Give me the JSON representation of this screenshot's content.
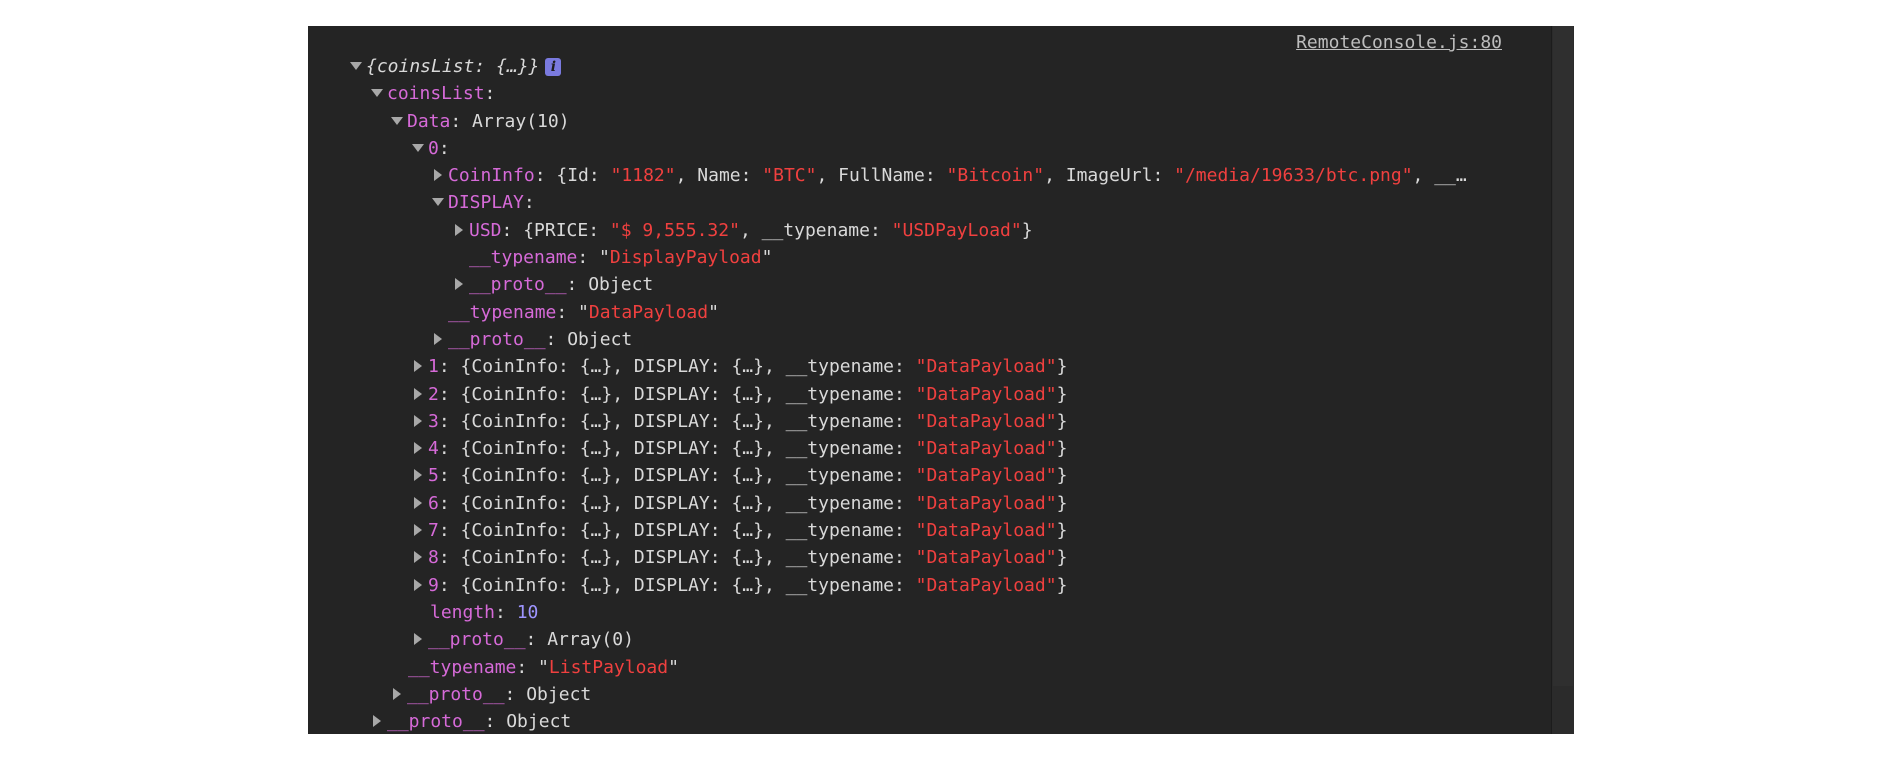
{
  "source_link": "RemoteConsole.js:80",
  "root": {
    "summary": "{coinsList: {…}}",
    "info_badge": "i"
  },
  "coinsList": {
    "key": "coinsList",
    "colon": ":"
  },
  "data_node": {
    "key": "Data",
    "value": ": Array(10)"
  },
  "item0": {
    "key": "0",
    "coininfo": {
      "key": "CoinInfo",
      "p1": ": {Id: ",
      "id_val": "\"1182\"",
      "p2": ", Name: ",
      "name_val": "\"BTC\"",
      "p3": ", FullName: ",
      "fullname_val": "\"Bitcoin\"",
      "p4": ", ImageUrl: ",
      "imageurl_val": "\"/media/19633/btc.png\"",
      "p5": ", __…"
    },
    "display": {
      "key": "DISPLAY",
      "usd_key": "USD",
      "usd_p1": ": {PRICE: ",
      "usd_price": "\"$ 9,555.32\"",
      "usd_p2": ", __typename: ",
      "usd_typename": "\"USDPayLoad\"",
      "usd_p3": "}",
      "typename_key": "__typename",
      "typename_val": "DisplayPayload",
      "proto_key": "__proto__",
      "proto_val": ": Object"
    },
    "typename_key": "__typename",
    "typename_val": "DataPayload",
    "proto_key": "__proto__",
    "proto_val": ": Object"
  },
  "items": [
    {
      "index": "1",
      "summary": ": {CoinInfo: {…}, DISPLAY: {…}, __typename: ",
      "typename": "\"DataPayload\"",
      "close": "}"
    },
    {
      "index": "2",
      "summary": ": {CoinInfo: {…}, DISPLAY: {…}, __typename: ",
      "typename": "\"DataPayload\"",
      "close": "}"
    },
    {
      "index": "3",
      "summary": ": {CoinInfo: {…}, DISPLAY: {…}, __typename: ",
      "typename": "\"DataPayload\"",
      "close": "}"
    },
    {
      "index": "4",
      "summary": ": {CoinInfo: {…}, DISPLAY: {…}, __typename: ",
      "typename": "\"DataPayload\"",
      "close": "}"
    },
    {
      "index": "5",
      "summary": ": {CoinInfo: {…}, DISPLAY: {…}, __typename: ",
      "typename": "\"DataPayload\"",
      "close": "}"
    },
    {
      "index": "6",
      "summary": ": {CoinInfo: {…}, DISPLAY: {…}, __typename: ",
      "typename": "\"DataPayload\"",
      "close": "}"
    },
    {
      "index": "7",
      "summary": ": {CoinInfo: {…}, DISPLAY: {…}, __typename: ",
      "typename": "\"DataPayload\"",
      "close": "}"
    },
    {
      "index": "8",
      "summary": ": {CoinInfo: {…}, DISPLAY: {…}, __typename: ",
      "typename": "\"DataPayload\"",
      "close": "}"
    },
    {
      "index": "9",
      "summary": ": {CoinInfo: {…}, DISPLAY: {…}, __typename: ",
      "typename": "\"DataPayload\"",
      "close": "}"
    }
  ],
  "data_length": {
    "key": "length",
    "value": "10"
  },
  "data_proto": {
    "key": "__proto__",
    "value": ": Array(0)"
  },
  "list_typename": {
    "key": "__typename",
    "value": "ListPayload"
  },
  "coinslist_proto": {
    "key": "__proto__",
    "value": ": Object"
  },
  "root_proto": {
    "key": "__proto__",
    "value": ": Object"
  },
  "colors": {
    "background": "#242424",
    "key": "#d66ad8",
    "string": "#f0403f",
    "number": "#9e95ff",
    "text": "#d9d9d9"
  }
}
